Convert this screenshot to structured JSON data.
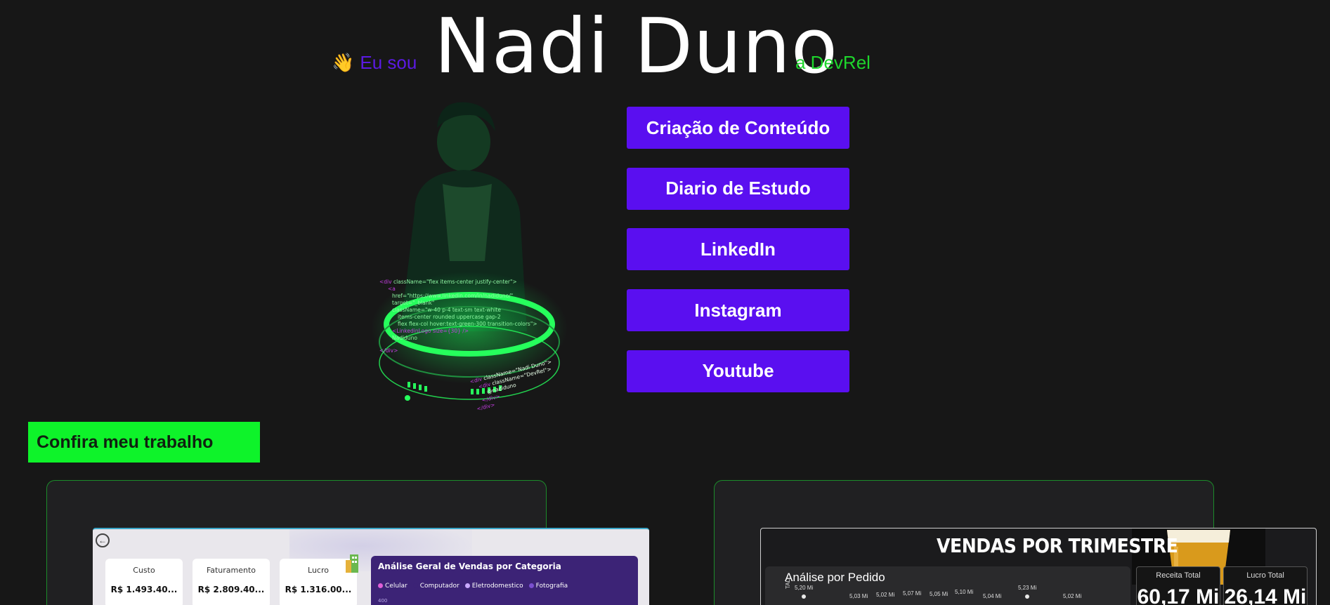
{
  "header": {
    "wave_emoji": "👋",
    "greeting": "Eu sou",
    "name": "Nadi Duno",
    "role": "a DevRel"
  },
  "portrait": {
    "icon": "developer-avatar-illustration",
    "code_lines": [
      "<div className=\"flex items-center justify-center\">",
      "<a",
      "href=\"https://www.linkedin.com/in/nadiduno/\"",
      "target=\"_blank\"",
      "className=\"w-40 p-4 text-sm  text-white",
      "items-center rounded uppercase gap-2",
      "flex flex-col hover:text-green-300 transition-colors\">",
      "<LinkedinLogo size={30} />",
      "Nadiduno",
      "</div>"
    ],
    "ring_lines": [
      "<div className=\"Nadi Duno\">",
      "<div className=\"DevRel\">",
      "@nadiduno",
      "</div>",
      "</div>"
    ]
  },
  "links": [
    {
      "label": "Criação de Conteúdo"
    },
    {
      "label": "Diario de Estudo"
    },
    {
      "label": "LinkedIn"
    },
    {
      "label": "Instagram"
    },
    {
      "label": "Youtube"
    }
  ],
  "work_section": {
    "heading": "Confira meu trabalho"
  },
  "projects": {
    "left": {
      "kpis": [
        {
          "label": "Custo",
          "value": "R$ 1.493.40..."
        },
        {
          "label": "Faturamento",
          "value": "R$ 2.809.40..."
        },
        {
          "label": "Lucro",
          "value": "R$ 1.316.00..."
        }
      ],
      "panel_title": "Análise Geral de Vendas por Categoria",
      "legend": [
        {
          "label": "Celular",
          "color": "#e05fd8"
        },
        {
          "label": "Computador",
          "color": "#3c2376"
        },
        {
          "label": "Eletrodomestico",
          "color": "#c9a9ff"
        },
        {
          "label": "Fotografia",
          "color": "#7b4fd0"
        }
      ],
      "axis_tick": "400"
    },
    "right": {
      "title": "VENDAS POR TRIMESTRE",
      "panel_title": "Análise por Pedido",
      "axis_label": "TAL",
      "point_labels": [
        "5,20 Mi",
        "5,03 Mi",
        "5,02 Mi",
        "5,07 Mi",
        "5,05 Mi",
        "5,10 Mi",
        "5,04 Mi",
        "5,23 Mi",
        "5,02 Mi"
      ],
      "kpis": [
        {
          "label": "Receita Total",
          "value": "60,17 Mi"
        },
        {
          "label": "Lucro Total",
          "value": "26,14 Mi"
        }
      ]
    }
  },
  "colors": {
    "background": "#171717",
    "accent_purple": "#5a0ff0",
    "accent_green": "#0ef32a"
  }
}
